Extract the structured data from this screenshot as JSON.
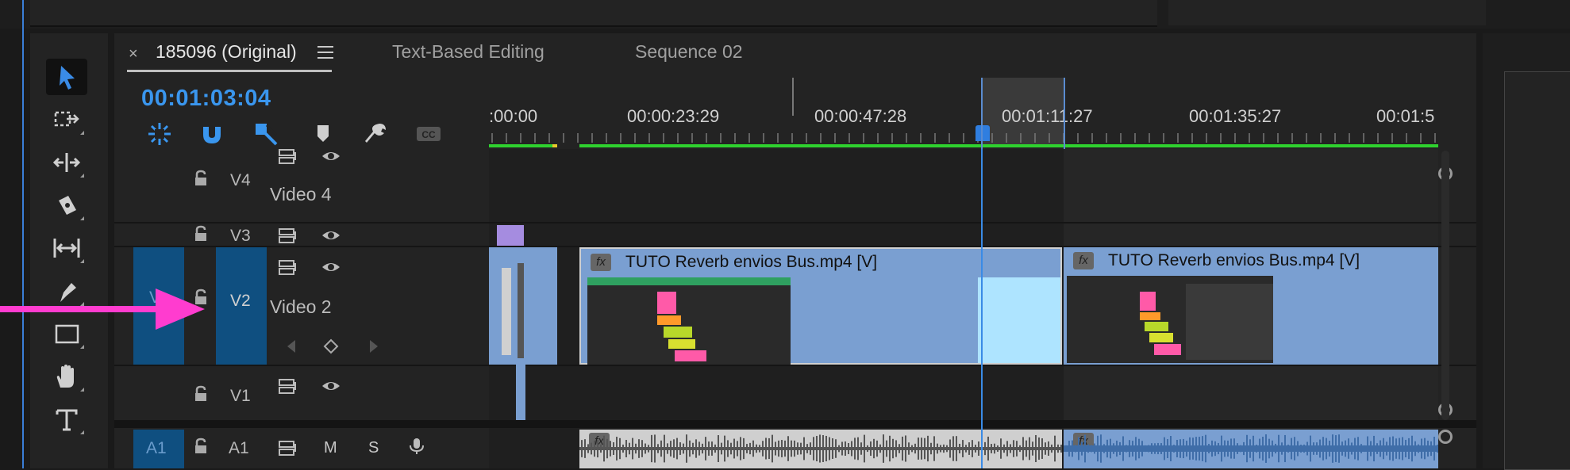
{
  "tabs": {
    "active": {
      "close": "×",
      "label": "185096 (Original)"
    },
    "items": [
      {
        "label": "Text-Based Editing"
      },
      {
        "label": "Sequence 02"
      }
    ]
  },
  "timecode": "00:01:03:04",
  "ruler": {
    "labels": [
      ":00:00",
      "00:00:23:29",
      "00:00:47:28",
      "00:01:11:27",
      "00:01:35:27",
      "00:01:5"
    ]
  },
  "tracks": {
    "v4": {
      "label": "V4",
      "name": "Video 4"
    },
    "v3": {
      "label": "V3"
    },
    "v2": {
      "source": "V",
      "label": "V2",
      "name": "Video 2"
    },
    "v1": {
      "label": "V1"
    },
    "a1": {
      "source": "A1",
      "label": "A1",
      "mute": "M",
      "solo": "S"
    }
  },
  "clips": [
    {
      "title": "TUTO Reverb envios Bus.mp4 [V]",
      "fx": "fx"
    },
    {
      "title": "TUTO Reverb envios Bus.mp4 [V]",
      "fx": "fx"
    }
  ],
  "audio_clips": [
    {
      "fx": "fx"
    },
    {
      "fx": "fx"
    }
  ],
  "colors": {
    "accent": "#3a96ee",
    "track_target": "#0f4f80",
    "clip_blue": "#7a9fd1",
    "work_area": "#2fd12f",
    "annotation_arrow": "#ff3ccf"
  }
}
